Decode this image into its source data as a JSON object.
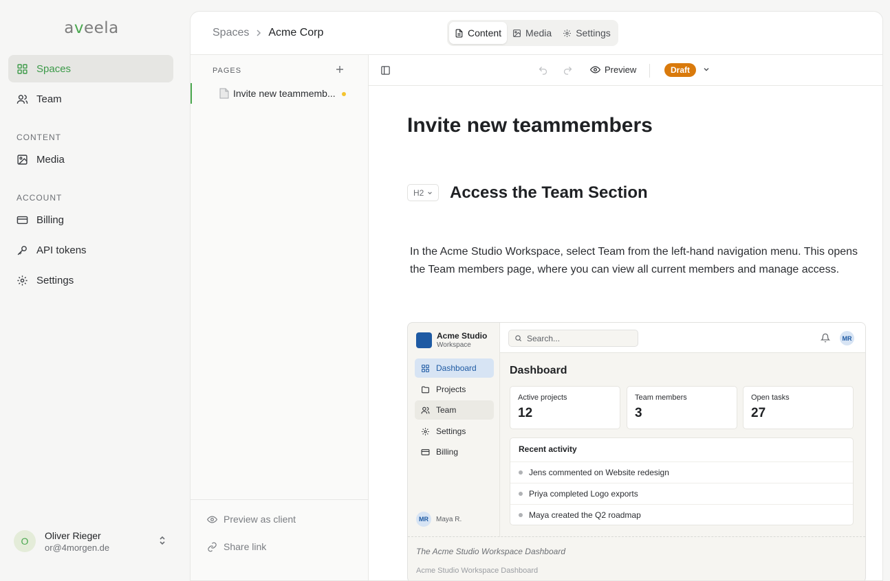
{
  "app": {
    "logo_a": "a",
    "logo_v": "v",
    "logo_rest": "eela"
  },
  "sidebar": {
    "items": [
      {
        "label": "Spaces",
        "icon": "grid-icon",
        "active": true
      },
      {
        "label": "Team",
        "icon": "users-icon"
      }
    ],
    "sections": [
      {
        "label": "CONTENT",
        "items": [
          {
            "label": "Media",
            "icon": "image-icon"
          }
        ]
      },
      {
        "label": "ACCOUNT",
        "items": [
          {
            "label": "Billing",
            "icon": "credit-card-icon"
          },
          {
            "label": "API tokens",
            "icon": "key-icon"
          },
          {
            "label": "Settings",
            "icon": "gear-icon"
          }
        ]
      }
    ],
    "user": {
      "initial": "O",
      "name": "Oliver Rieger",
      "email": "or@4morgen.de"
    }
  },
  "header": {
    "breadcrumb": {
      "parent": "Spaces",
      "current": "Acme Corp"
    },
    "tabs": [
      {
        "label": "Content",
        "icon": "document-icon",
        "active": true
      },
      {
        "label": "Media",
        "icon": "image-icon"
      },
      {
        "label": "Settings",
        "icon": "gear-icon"
      }
    ]
  },
  "pages": {
    "heading": "PAGES",
    "items": [
      {
        "label": "Invite new teammemb...",
        "unsaved": true
      }
    ],
    "footer": {
      "preview": "Preview as client",
      "share": "Share link"
    }
  },
  "toolbar": {
    "preview": "Preview",
    "status": "Draft"
  },
  "document": {
    "title": "Invite new teammembers",
    "h2_tag": "H2",
    "h2": "Access the Team Section",
    "paragraph": "In the Acme Studio Workspace, select Team from the left-hand navigation menu. This opens the Team members page, where you can view all current members and manage access.",
    "caption": "The Acme Studio Workspace Dashboard",
    "caption2": "Acme Studio Workspace Dashboard"
  },
  "screenshot": {
    "brand": "Acme Studio",
    "brand_sub": "Workspace",
    "nav": [
      {
        "label": "Dashboard",
        "icon": "grid-icon",
        "active": true
      },
      {
        "label": "Projects",
        "icon": "folder-icon"
      },
      {
        "label": "Team",
        "icon": "users-icon",
        "hover": true
      },
      {
        "label": "Settings",
        "icon": "gear-icon"
      },
      {
        "label": "Billing",
        "icon": "credit-card-icon"
      }
    ],
    "search_placeholder": "Search...",
    "avatar": "MR",
    "user": "Maya R.",
    "heading": "Dashboard",
    "cards": [
      {
        "label": "Active projects",
        "value": "12"
      },
      {
        "label": "Team members",
        "value": "3"
      },
      {
        "label": "Open tasks",
        "value": "27"
      }
    ],
    "activity_heading": "Recent activity",
    "activity": [
      "Jens commented on Website redesign",
      "Priya completed Logo exports",
      "Maya created the Q2 roadmap"
    ]
  },
  "colors": {
    "accent": "#4aa84f",
    "draft": "#d97a0c",
    "brand_blue": "#1e5aa3"
  }
}
